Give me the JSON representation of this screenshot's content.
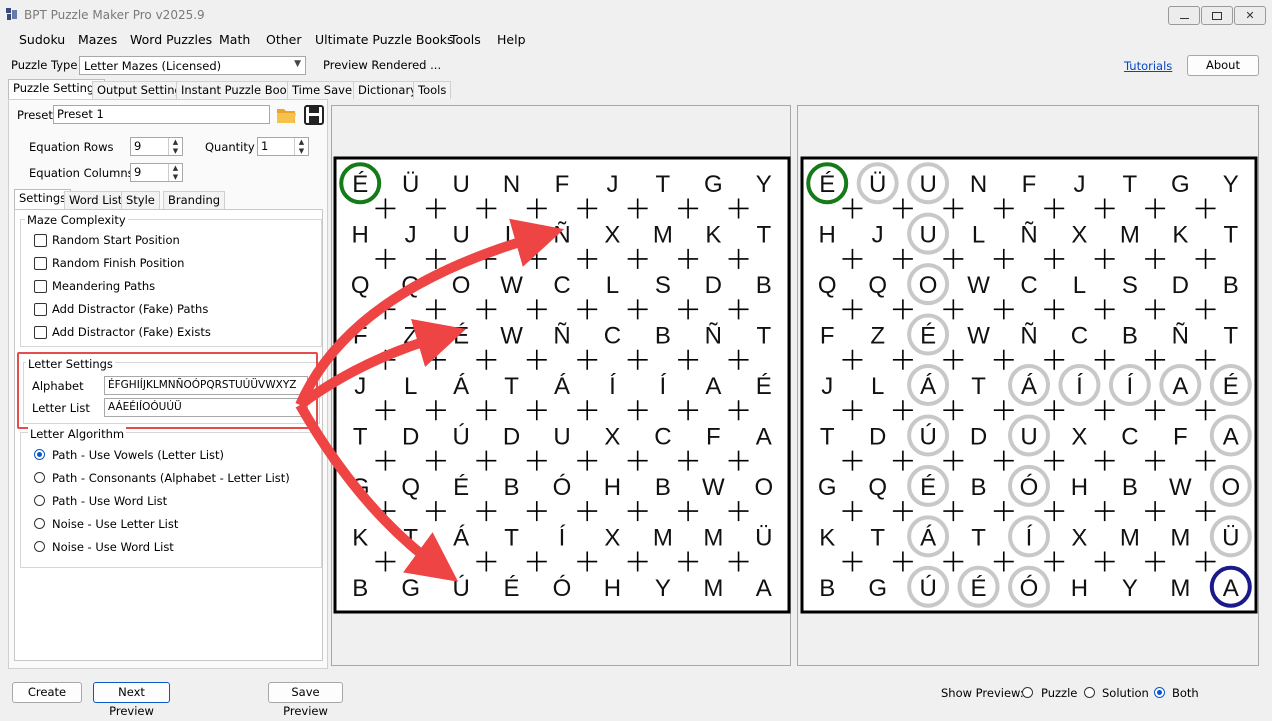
{
  "app": {
    "title": "BPT Puzzle Maker Pro v2025.9",
    "minimize": "▭",
    "restore": "▣",
    "close": "✕"
  },
  "menu": [
    "Sudoku",
    "Mazes",
    "Word Puzzles",
    "Math",
    "Other",
    "Ultimate Puzzle Books",
    "Tools",
    "Help"
  ],
  "toolbar": {
    "puzzle_type_label": "Puzzle Type",
    "puzzle_type_value": "Letter Mazes (Licensed)",
    "status": "Preview Rendered ...",
    "tutorials": "Tutorials",
    "about": "About"
  },
  "main_tabs": [
    "Puzzle Settings",
    "Output Settings",
    "Instant Puzzle Books",
    "Time Saver",
    "Dictionary",
    "Tools"
  ],
  "preset": {
    "label": "Preset",
    "value": "Preset 1"
  },
  "equation_rows": {
    "label": "Equation Rows",
    "value": "9"
  },
  "equation_columns": {
    "label": "Equation Columns",
    "value": "9"
  },
  "quantity": {
    "label": "Quantity",
    "value": "1"
  },
  "sub_tabs": [
    "Settings",
    "Word List",
    "Style",
    "Branding"
  ],
  "maze_complexity": {
    "title": "Maze Complexity",
    "options": [
      "Random Start Position",
      "Random Finish Position",
      "Meandering Paths",
      "Add Distractor (Fake) Paths",
      "Add Distractor (Fake) Exists"
    ]
  },
  "letter_settings": {
    "title": "Letter Settings",
    "alphabet_label": "Alphabet",
    "alphabet_value": "ÉFGHIÍJKLMNÑOÓPQRSTUÚÜVWXYZ",
    "letter_list_label": "Letter List",
    "letter_list_value": "AÁEÉIÍOÓUÚÜ"
  },
  "letter_algorithm": {
    "title": "Letter Algorithm",
    "options": [
      "Path - Use Vowels (Letter List)",
      "Path - Consonants (Alphabet - Letter List)",
      "Path - Use Word List",
      "Noise - Use Letter List",
      "Noise - Use Word List"
    ],
    "selected": 0
  },
  "grid": [
    [
      "É",
      "Ü",
      "U",
      "N",
      "F",
      "J",
      "T",
      "G",
      "Y"
    ],
    [
      "H",
      "J",
      "U",
      "L",
      "Ñ",
      "X",
      "M",
      "K",
      "T"
    ],
    [
      "Q",
      "Q",
      "O",
      "W",
      "C",
      "L",
      "S",
      "D",
      "B"
    ],
    [
      "F",
      "Z",
      "É",
      "W",
      "Ñ",
      "C",
      "B",
      "Ñ",
      "T"
    ],
    [
      "J",
      "L",
      "Á",
      "T",
      "Á",
      "Í",
      "Í",
      "A",
      "É"
    ],
    [
      "T",
      "D",
      "Ú",
      "D",
      "U",
      "X",
      "C",
      "F",
      "A"
    ],
    [
      "G",
      "Q",
      "É",
      "B",
      "Ó",
      "H",
      "B",
      "W",
      "O"
    ],
    [
      "K",
      "T",
      "Á",
      "T",
      "Í",
      "X",
      "M",
      "M",
      "Ü"
    ],
    [
      "B",
      "G",
      "Ú",
      "É",
      "Ó",
      "H",
      "Y",
      "M",
      "A"
    ]
  ],
  "start_cell": [
    0,
    0
  ],
  "finish_cell": [
    8,
    8
  ],
  "solution_path": [
    [
      0,
      1
    ],
    [
      0,
      2
    ],
    [
      1,
      2
    ],
    [
      2,
      2
    ],
    [
      3,
      2
    ],
    [
      4,
      2
    ],
    [
      5,
      2
    ],
    [
      6,
      2
    ],
    [
      7,
      2
    ],
    [
      8,
      2
    ],
    [
      8,
      3
    ],
    [
      8,
      4
    ],
    [
      7,
      4
    ],
    [
      6,
      4
    ],
    [
      5,
      4
    ],
    [
      4,
      4
    ],
    [
      4,
      5
    ],
    [
      4,
      6
    ],
    [
      4,
      7
    ],
    [
      4,
      8
    ],
    [
      5,
      8
    ],
    [
      6,
      8
    ],
    [
      7,
      8
    ]
  ],
  "colors": {
    "start": "#157a18",
    "finish": "#1a1a8c",
    "path": "#c8c8c8",
    "arrow": "#ee4444",
    "highlight": "#e74c4c"
  },
  "bottom": {
    "create": "Create",
    "next_preview": "Next Preview",
    "save_preview": "Save Preview",
    "show_preview_label": "Show Preview:",
    "options": [
      "Puzzle",
      "Solution",
      "Both"
    ],
    "selected": 2
  }
}
